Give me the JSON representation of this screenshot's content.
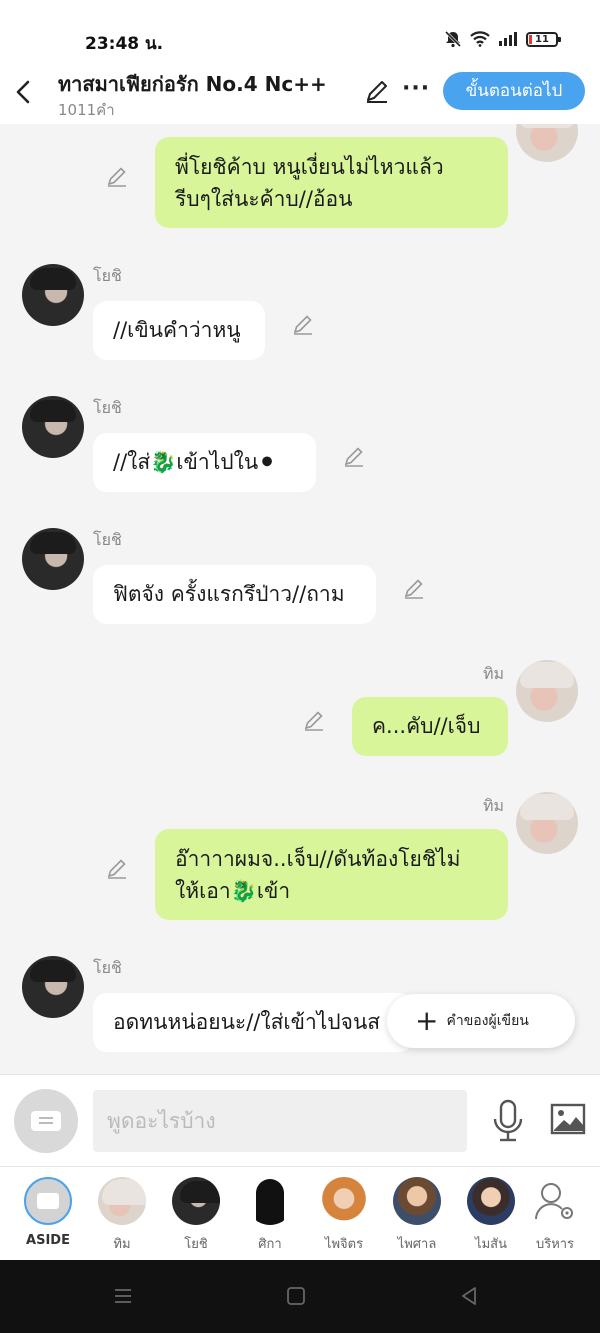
{
  "status": {
    "time": "23:48 น.",
    "battery": "11"
  },
  "header": {
    "title": "ทาสมาเฟียก่อรัก No.4 Nc++",
    "word_count": "1011คำ",
    "next_label": "ขั้นตอนต่อไป",
    "more": "···"
  },
  "messages": [
    {
      "side": "right",
      "text_line1": "พี่โยชิค้าบ หนูเงี่ยนไม่ไหวแล้ว",
      "text_line2": "รีบๆใส่นะค้าบ//อ้อน"
    },
    {
      "side": "left",
      "name": "โยชิ",
      "text": "//เขินคำว่าหนู"
    },
    {
      "side": "left",
      "name": "โยชิ",
      "text": "//ใส่🐉เข้าไปใน⚫"
    },
    {
      "side": "left",
      "name": "โยชิ",
      "text": "ฟิตจัง ครั้งแรกรึป่าว//ถาม"
    },
    {
      "side": "right",
      "name": "ทิม",
      "text": "ค...คับ//เจ็บ"
    },
    {
      "side": "right",
      "name": "ทิม",
      "text_line1": "อ๊าาาาผมจ..เจ็บ//ดันท้องโยชิไม่",
      "text_line2": "ให้เอา🐉เข้า"
    },
    {
      "side": "left",
      "name": "โยชิ",
      "text": "อดทนหน่อยนะ//ใส่เข้าไปจนส"
    }
  ],
  "aside_note": {
    "plus": "+",
    "label": "คำของผู้เขียน"
  },
  "input": {
    "placeholder": "พูดอะไรบ้าง"
  },
  "characters": [
    {
      "label": "ASIDE"
    },
    {
      "label": "ทิม"
    },
    {
      "label": "โยชิ"
    },
    {
      "label": "ศิกา"
    },
    {
      "label": "ไพจิตร"
    },
    {
      "label": "ไพศาล"
    },
    {
      "label": "ไมสัน"
    },
    {
      "label": "บริหาร"
    }
  ],
  "colors": {
    "accent": "#4aa3ee",
    "bubble_right": "#d8f59a",
    "bubble_left": "#ffffff"
  }
}
